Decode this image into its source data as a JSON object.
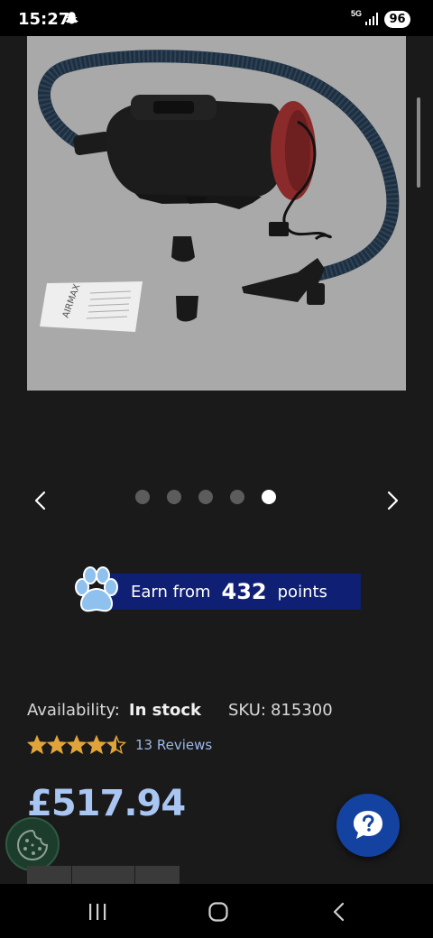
{
  "status_bar": {
    "time": "15:27",
    "network": "5G",
    "battery": "96"
  },
  "product": {
    "image_alt": "Dog grooming dryer with hose",
    "carousel": {
      "total_slides": 5,
      "active_slide": 5
    },
    "points": {
      "prefix": "Earn from",
      "value": "432",
      "suffix": "points"
    },
    "availability_label": "Availability:",
    "availability_value": "In stock",
    "sku_label": "SKU:",
    "sku_value": "815300",
    "rating": 4.5,
    "reviews": "13 Reviews",
    "price": "£517.94"
  },
  "icons": {
    "cookie": "cookie-icon",
    "help": "question-icon",
    "prev": "chevron-left-icon",
    "next": "chevron-right-icon"
  },
  "colors": {
    "background": "#1a1a1a",
    "points_bar": "#0f1f73",
    "price": "#a9c6f2",
    "star": "#e0a43a",
    "help_button": "#1442a0"
  }
}
